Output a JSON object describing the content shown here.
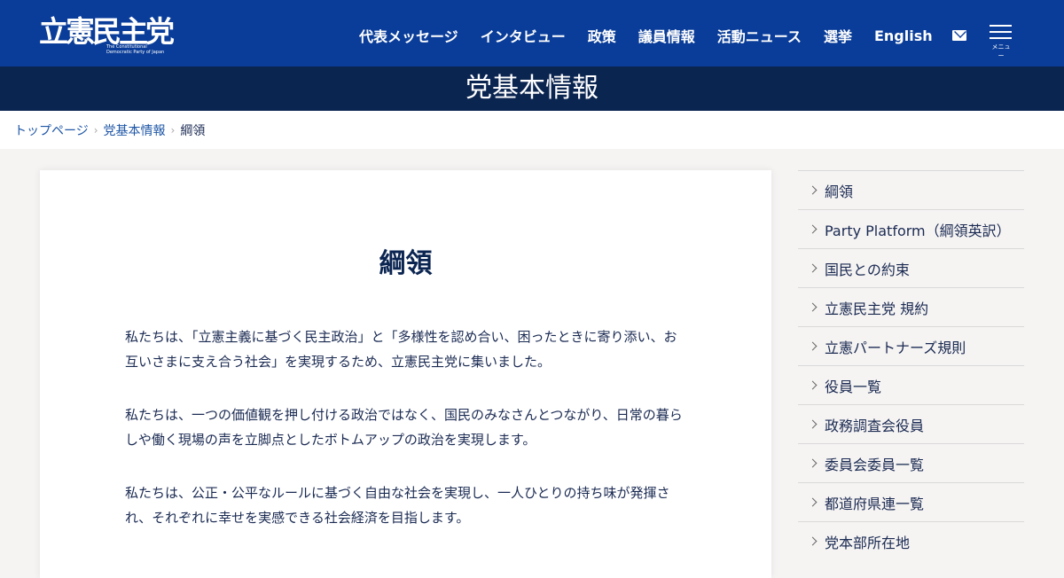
{
  "header": {
    "logo_main": "立憲民主党",
    "logo_en": "The Constitutional\nDemocratic Party of Japan",
    "nav": [
      "代表メッセージ",
      "インタビュー",
      "政策",
      "議員情報",
      "活動ニュース",
      "選挙",
      "English"
    ],
    "icons": [
      "envelope-icon",
      "hamburger-menu-icon"
    ],
    "menu_label": "メニュー"
  },
  "page_title": "党基本情報",
  "breadcrumb": {
    "items": [
      "トップページ",
      "党基本情報"
    ],
    "current": "綱領"
  },
  "main": {
    "heading": "綱領",
    "paragraphs": [
      "私たちは、「立憲主義に基づく民主政治」と「多様性を認め合い、困ったときに寄り添い、お互いさまに支え合う社会」を実現するため、立憲民主党に集いました。",
      "私たちは、一つの価値観を押し付ける政治ではなく、国民のみなさんとつながり、日常の暮らしや働く現場の声を立脚点としたボトムアップの政治を実現します。",
      "私たちは、公正・公平なルールに基づく自由な社会を実現し、一人ひとりの持ち味が発揮され、それぞれに幸せを実感できる社会経済を目指します。"
    ]
  },
  "sidebar": {
    "items": [
      "綱領",
      "Party Platform（綱領英訳）",
      "国民との約束",
      "立憲民主党 規約",
      "立憲パートナーズ規則",
      "役員一覧",
      "政務調査会役員",
      "委員会委員一覧",
      "都道府県連一覧",
      "党本部所在地"
    ]
  },
  "colors": {
    "header_blue": "#0a3d99",
    "title_band_navy": "#0b2551",
    "link_blue": "#1e56a6",
    "page_bg": "#f6f4f3"
  }
}
